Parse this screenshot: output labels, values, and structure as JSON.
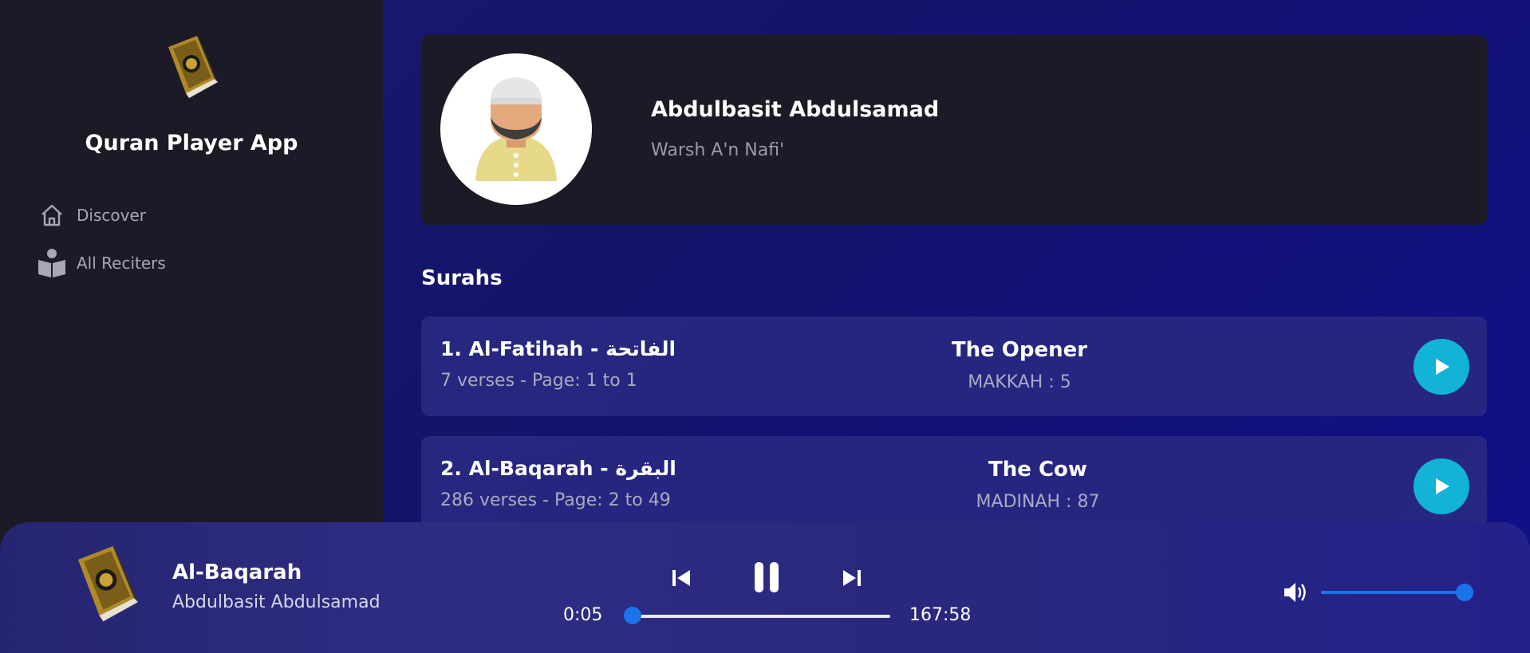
{
  "app": {
    "title": "Quran Player App"
  },
  "nav": [
    {
      "label": "Discover",
      "icon": "home-icon"
    },
    {
      "label": "All Reciters",
      "icon": "reader-icon"
    }
  ],
  "reciter": {
    "name": "Abdulbasit Abdulsamad",
    "riwaya": "Warsh A'n Nafi'"
  },
  "surahs_title": "Surahs",
  "surahs": [
    {
      "name": "1. Al-Fatihah - الفاتحة",
      "meta": "7 verses - Page: 1 to 1",
      "english": "The Opener",
      "revelation": "MAKKAH : 5"
    },
    {
      "name": "2. Al-Baqarah - البقرة",
      "meta": "286 verses - Page: 2 to 49",
      "english": "The Cow",
      "revelation": "MADINAH : 87"
    }
  ],
  "player": {
    "title": "Al-Baqarah",
    "artist": "Abdulbasit Abdulsamad",
    "current_time": "0:05",
    "duration": "167:58",
    "progress": 0.0005,
    "volume": 1.0
  },
  "colors": {
    "accent": "#13b3d8",
    "slider": "#1a73e8",
    "sidebar": "#1b1a26"
  }
}
